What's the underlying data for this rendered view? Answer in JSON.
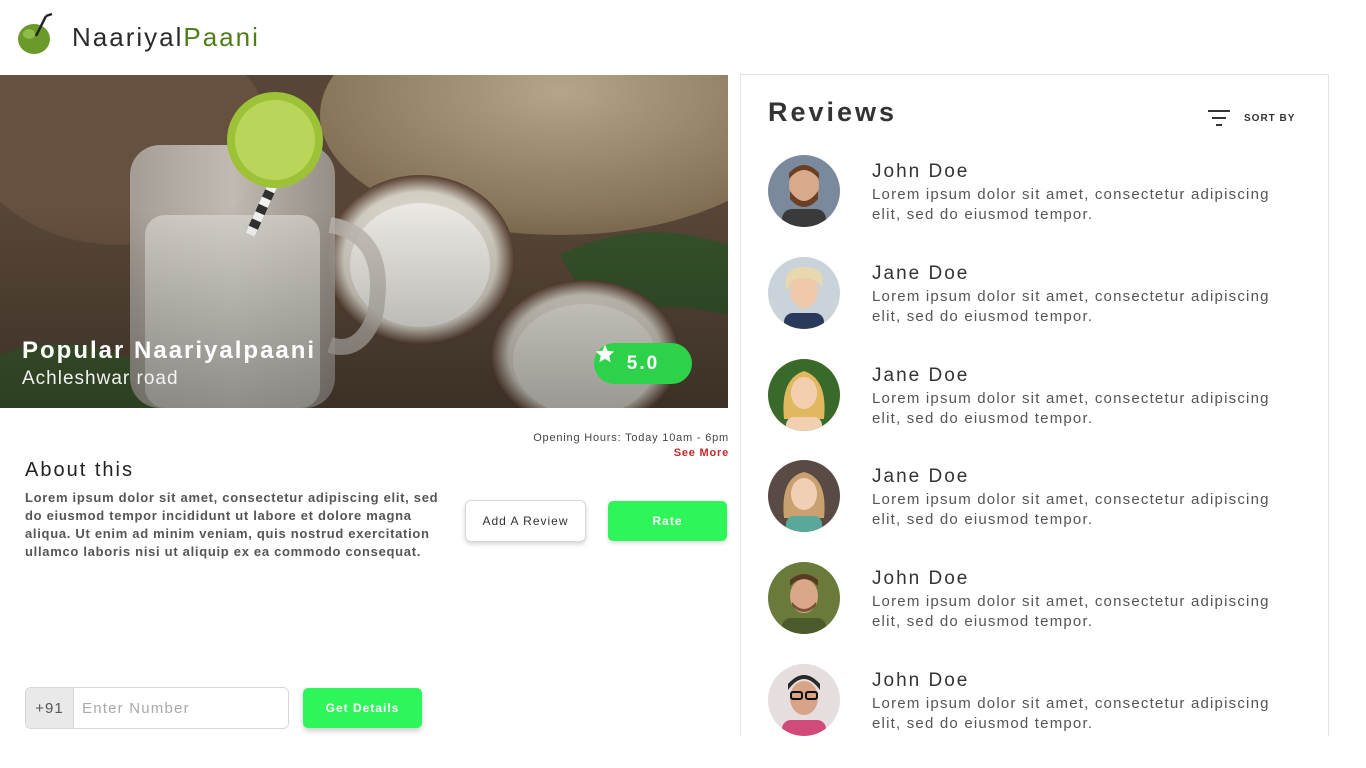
{
  "header": {
    "brand_part1": "Naariyal",
    "brand_part2": "Paani",
    "brand_color": "#4f7d19",
    "logo_icon": "coconut-icon"
  },
  "hero": {
    "title": "Popular Naariyalpaani",
    "subtitle": "Achleshwar road",
    "rating": "5.0",
    "rating_icon": "star-icon",
    "rating_color": "#2ed14a"
  },
  "info": {
    "opening_hours": "Opening Hours: Today 10am - 6pm",
    "see_more": "See More"
  },
  "about": {
    "title": "About this",
    "text": "Lorem ipsum dolor sit amet, consectetur adipiscing elit, sed do eiusmod tempor incididunt ut labore et dolore magna aliqua. Ut enim ad minim veniam, quis nostrud exercitation ullamco laboris nisi ut aliquip ex ea commodo consequat."
  },
  "actions": {
    "add_review": "Add A Review",
    "rate": "Rate",
    "accent": "#2ef55a"
  },
  "phone": {
    "prefix": "+91",
    "placeholder": "Enter Number",
    "value": "",
    "get_details": "Get Details"
  },
  "reviews": {
    "title": "Reviews",
    "sort_label": "SORT BY",
    "sort_icon": "filter-lines-icon",
    "items": [
      {
        "name": "John Doe",
        "text": "Lorem ipsum dolor sit amet, consectetur adipiscing elit, sed do eiusmod tempor."
      },
      {
        "name": "Jane Doe",
        "text": "Lorem ipsum dolor sit amet, consectetur adipiscing elit, sed do eiusmod tempor."
      },
      {
        "name": "Jane Doe",
        "text": "Lorem ipsum dolor sit amet, consectetur adipiscing elit, sed do eiusmod tempor."
      },
      {
        "name": "Jane Doe",
        "text": "Lorem ipsum dolor sit amet, consectetur adipiscing elit, sed do eiusmod tempor."
      },
      {
        "name": "John Doe",
        "text": "Lorem ipsum dolor sit amet, consectetur adipiscing elit, sed do eiusmod tempor."
      },
      {
        "name": "John Doe",
        "text": "Lorem ipsum dolor sit amet, consectetur adipiscing elit, sed do eiusmod tempor."
      }
    ]
  }
}
